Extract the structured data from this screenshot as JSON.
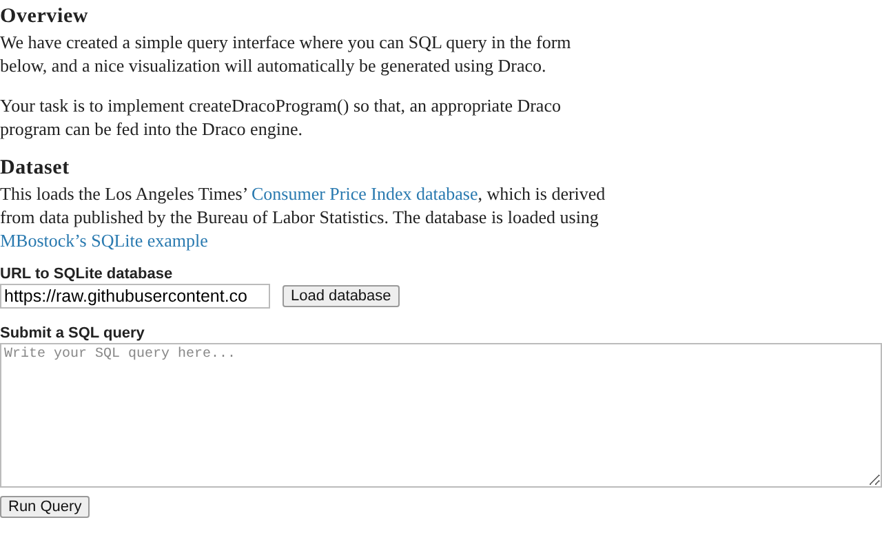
{
  "sections": [
    {
      "heading": "Overview",
      "paragraphs": [
        [
          {
            "kind": "text",
            "text": "We have created a simple query interface where you can SQL query in the form below, and a nice visualization will automatically be generated using Draco."
          }
        ],
        [
          {
            "kind": "text",
            "text": "Your task is to implement createDracoProgram() so that, an appropriate Draco program can be fed into the Draco engine."
          }
        ]
      ]
    },
    {
      "heading": "Dataset",
      "paragraphs": [
        [
          {
            "kind": "text",
            "text": "This loads the Los Angeles Times’ "
          },
          {
            "kind": "link",
            "text": "Consumer Price Index database"
          },
          {
            "kind": "text",
            "text": ", which is derived from data published by the Bureau of Labor Statistics. The database is loaded using "
          },
          {
            "kind": "link",
            "text": "MBostock’s SQLite example"
          }
        ]
      ]
    }
  ],
  "url_form": {
    "label": "URL to SQLite database",
    "value": "https://raw.githubusercontent.co",
    "button": "Load database"
  },
  "query_form": {
    "label": "Submit a SQL query",
    "placeholder": "Write your SQL query here...",
    "button": "Run Query"
  }
}
